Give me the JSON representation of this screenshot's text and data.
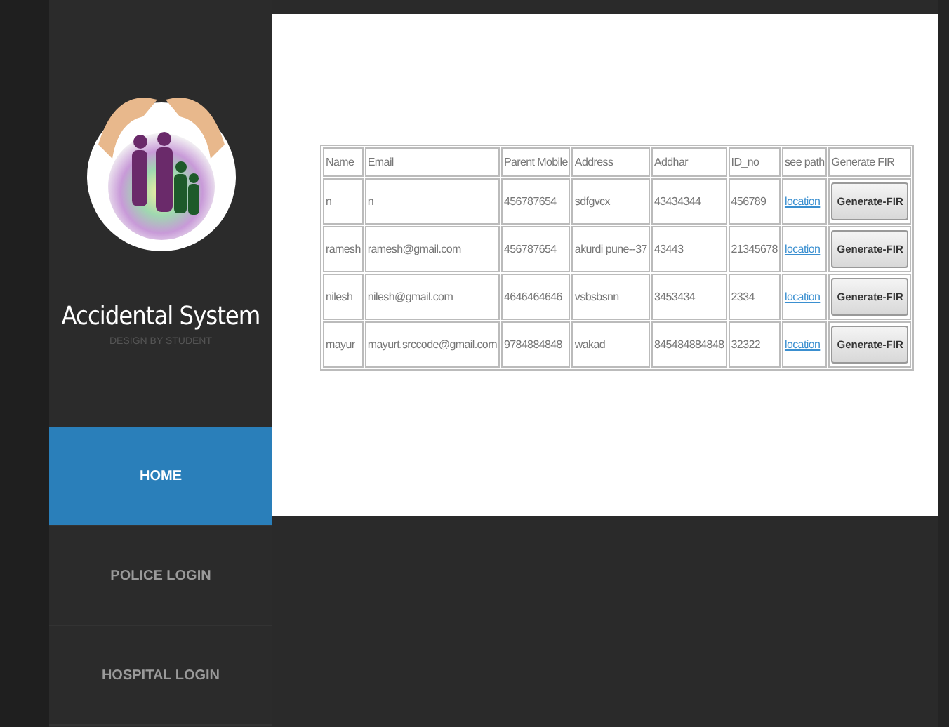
{
  "sidebar": {
    "title": "Accidental System",
    "subtitle": "DESIGN BY STUDENT",
    "nav": [
      {
        "label": "HOME",
        "selected": true
      },
      {
        "label": "POLICE LOGIN",
        "selected": false
      },
      {
        "label": "HOSPITAL LOGIN",
        "selected": false
      }
    ]
  },
  "table": {
    "columns": [
      "Name",
      "Email",
      "Parent Mobile",
      "Address",
      "Addhar",
      "ID_no",
      "see path",
      "Generate FIR"
    ],
    "rows": [
      {
        "cells": [
          "n",
          "n",
          "456787654",
          "sdfgvcx",
          "43434344",
          "456789"
        ],
        "link": "location",
        "button": "Generate-FIR"
      },
      {
        "cells": [
          "ramesh",
          "ramesh@gmail.com",
          "456787654",
          "akurdi pune--37",
          "43443",
          "21345678"
        ],
        "link": "location",
        "button": "Generate-FIR"
      },
      {
        "cells": [
          "nilesh",
          "nilesh@gmail.com",
          "4646464646",
          "vsbsbsnn",
          "3453434",
          "2334"
        ],
        "link": "location",
        "button": "Generate-FIR"
      },
      {
        "cells": [
          "mayur",
          "mayurt.srccode@gmail.com",
          "9784884848",
          "wakad",
          "845484884848",
          "32322"
        ],
        "link": "location",
        "button": "Generate-FIR"
      }
    ]
  }
}
